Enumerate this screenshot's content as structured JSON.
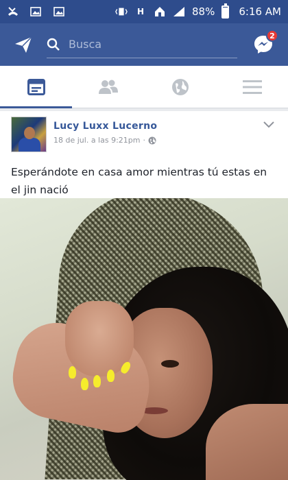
{
  "status_bar": {
    "battery": "88%",
    "battery_level": 0.88,
    "time": "6:16 AM",
    "left_icons": [
      "missed-call-icon",
      "image-notification-icon",
      "image-notification-icon"
    ],
    "right_icons": [
      "vibrate-icon",
      "h-signal-icon",
      "home-icon",
      "signal-bars-icon",
      "battery-icon"
    ]
  },
  "top_bar": {
    "search_placeholder": "Busca",
    "messenger_badge": "2"
  },
  "tabs": [
    {
      "name": "news-feed",
      "icon": "news-feed-icon",
      "active": true
    },
    {
      "name": "friends",
      "icon": "friends-icon",
      "active": false
    },
    {
      "name": "notifications",
      "icon": "globe-icon",
      "active": false
    },
    {
      "name": "menu",
      "icon": "hamburger-menu-icon",
      "active": false
    }
  ],
  "post": {
    "author": "Lucy Luxx Lucerno",
    "timestamp": "18 de jul. a las 9:21pm",
    "privacy_icon": "globe-icon",
    "text": "Esperándote en casa amor mientras tú estas en el jin nació"
  },
  "colors": {
    "brand": "#3b5998",
    "status_bar": "#2e4c8c",
    "badge": "#e53935"
  }
}
